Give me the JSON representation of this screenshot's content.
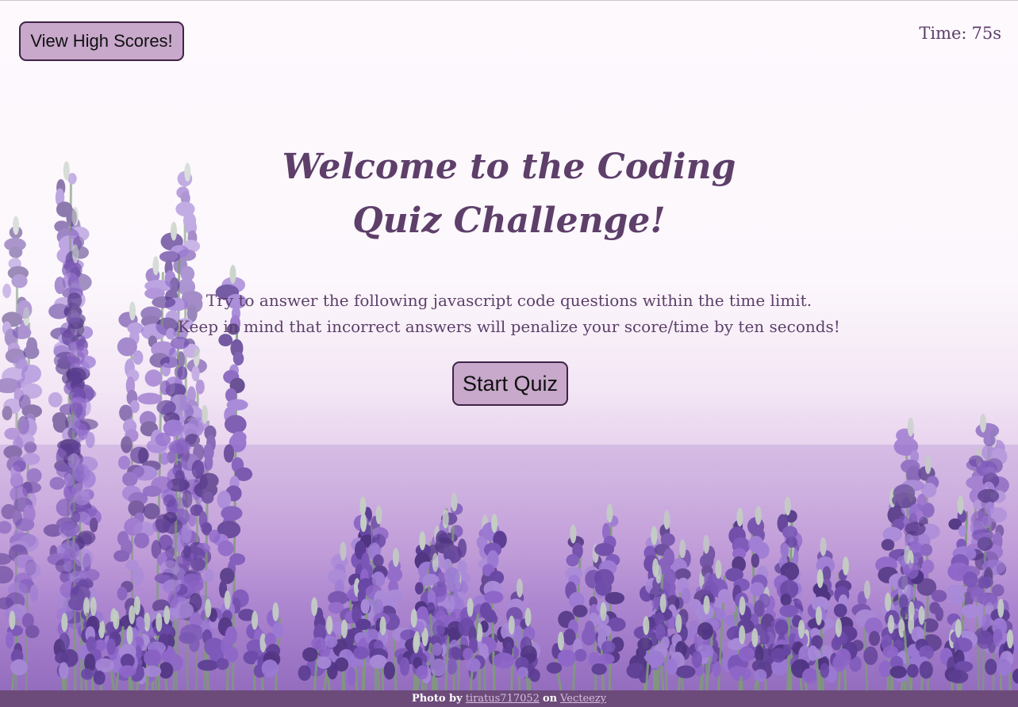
{
  "header": {
    "high_scores_label": "View High Scores!",
    "timer_label": "Time:",
    "timer_value": "75s"
  },
  "main": {
    "title_line1": "Welcome to the Coding",
    "title_line2": "Quiz Challenge!",
    "intro_line1": "Try to answer the following javascript code questions within the time limit.",
    "intro_line2": "Keep in mind that incorrect answers will penalize your score/time by ten seconds!",
    "start_label": "Start Quiz"
  },
  "footer": {
    "photo_by": "Photo by",
    "author_link": "tiratus717052",
    "on_text": "on",
    "site_link": "Vecteezy"
  },
  "colors": {
    "text": "#5d3f6a",
    "button_bg": "#c8a8cb",
    "button_border": "#3e2447",
    "footer_bg": "#6c4b7a",
    "footer_link": "#d8bfe0"
  },
  "background_image": "lavender-field-photo"
}
